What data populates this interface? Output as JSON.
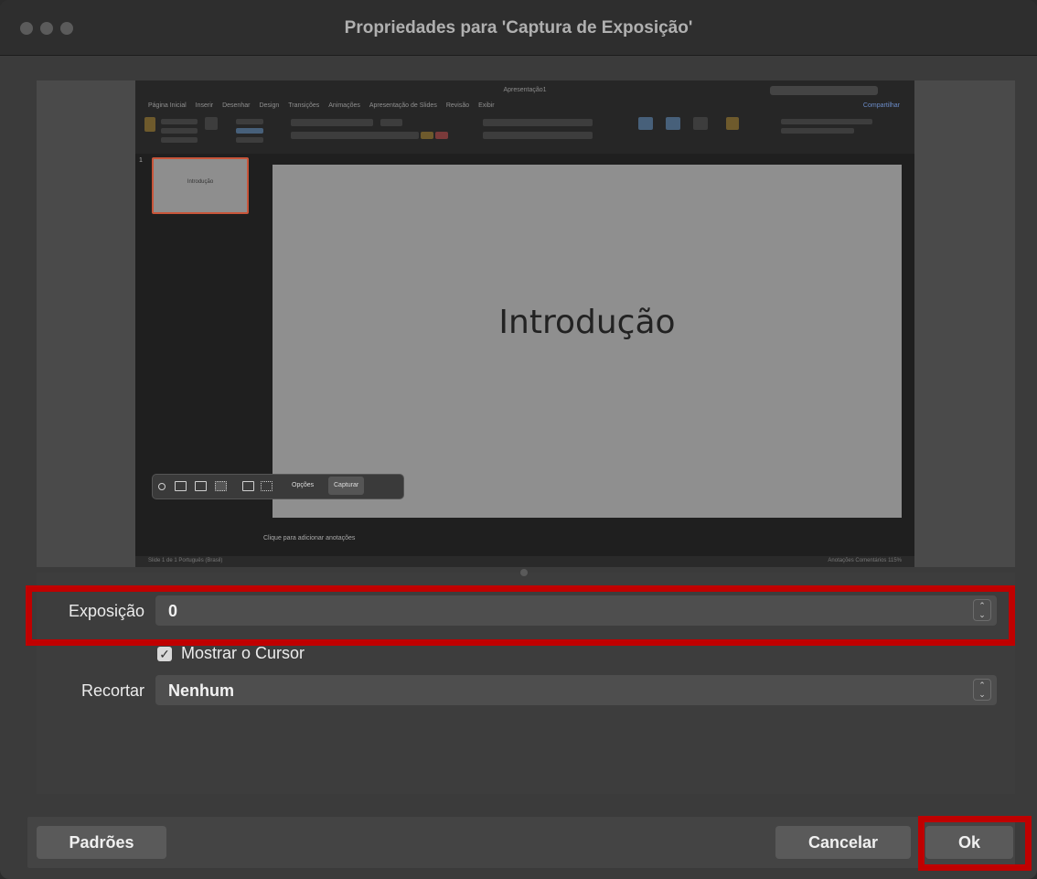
{
  "window": {
    "title": "Propriedades para 'Captura de Exposição'"
  },
  "preview": {
    "app_document_title": "Apresentação1",
    "ribbon_tabs": [
      "Página Inicial",
      "Inserir",
      "Desenhar",
      "Design",
      "Transições",
      "Animações",
      "Apresentação de Slides",
      "Revisão",
      "Exibir"
    ],
    "share_label": "Compartilhar",
    "slide_number": "1",
    "thumbnail_text": "Introdução",
    "slide_title": "Introdução",
    "notes_placeholder": "Clique para adicionar anotações",
    "status_left": "Slide 1 de 1   Português (Brasil)",
    "status_right": "Anotações   Comentários   115%",
    "capture_bar": {
      "options_label": "Opções",
      "capture_label": "Capturar"
    }
  },
  "form": {
    "exposure": {
      "label": "Exposição",
      "value": "0"
    },
    "show_cursor": {
      "label": "Mostrar o Cursor",
      "checked": true,
      "check_glyph": "✓"
    },
    "crop": {
      "label": "Recortar",
      "value": "Nenhum"
    },
    "stepper_glyph": "⌃⌄"
  },
  "footer": {
    "defaults_label": "Padrões",
    "cancel_label": "Cancelar",
    "ok_label": "Ok"
  },
  "colors": {
    "highlight": "#c00000",
    "window_bg": "#3b3b3b",
    "field_bg": "#4e4e4e"
  }
}
